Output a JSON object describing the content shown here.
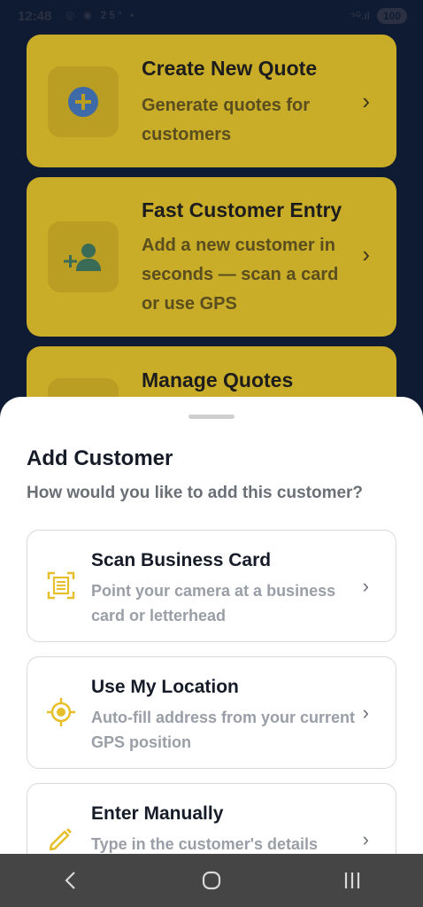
{
  "status": {
    "time": "12:48",
    "left_icons": "◎ ◉ 25° •",
    "signal": "⁵ᴳ.ıl",
    "battery": "100"
  },
  "background": {
    "cards": [
      {
        "title": "Create New Quote",
        "subtitle": "Generate quotes for customers",
        "icon": "plus-circle-icon"
      },
      {
        "title": "Fast Customer Entry",
        "subtitle": "Add a new customer in seconds — scan a card or use GPS",
        "icon": "person-add-icon"
      },
      {
        "title": "Manage Quotes",
        "subtitle": "",
        "icon": ""
      }
    ]
  },
  "sheet": {
    "title": "Add Customer",
    "subtitle": "How would you like to add this customer?",
    "options": [
      {
        "title": "Scan Business Card",
        "description": "Point your camera at a business card or letterhead",
        "icon": "document-scanner-icon"
      },
      {
        "title": "Use My Location",
        "description": "Auto-fill address from your current GPS position",
        "icon": "gps-location-icon"
      },
      {
        "title": "Enter Manually",
        "description": "Type in the customer's details",
        "icon": "pencil-icon"
      }
    ]
  },
  "colors": {
    "accent_yellow": "#f2c230",
    "background_dark": "#0f1a33",
    "card_yellow_dimmed": "#c9ac27",
    "nav_bar": "#454545"
  },
  "nav": {
    "back_icon": "back-chevron-icon",
    "home_icon": "home-circle-icon",
    "recents_icon": "recents-bars-icon"
  }
}
